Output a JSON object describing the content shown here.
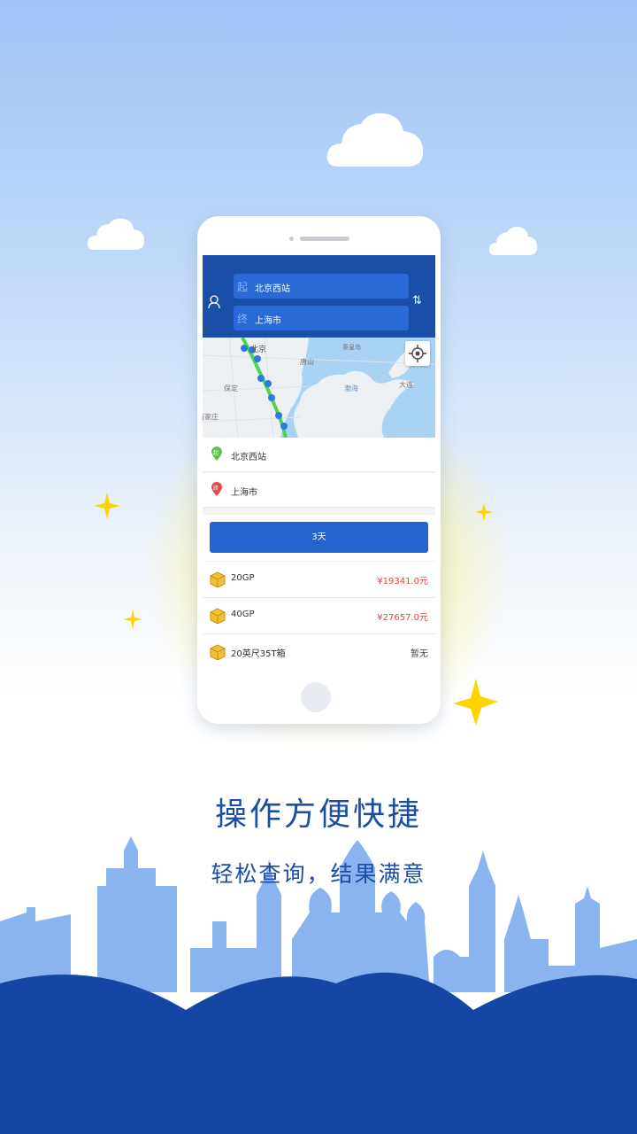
{
  "route": {
    "origin_tag": "起",
    "origin_value": "北京西站",
    "destination_tag": "终",
    "destination_value": "上海市",
    "swap_symbol": "⇅"
  },
  "map": {
    "labels": [
      "北京",
      "唐山",
      "秦皇岛",
      "保定",
      "渤海",
      "大连",
      "石家庄"
    ]
  },
  "stops": [
    {
      "badge": "起",
      "name": "北京西站",
      "color": "#5cc24a"
    },
    {
      "badge": "终",
      "name": "上海市",
      "color": "#e24a4a"
    }
  ],
  "duration_button": "3天",
  "quotes": [
    {
      "container": "20GP",
      "price": "¥19341.0元"
    },
    {
      "container": "40GP",
      "price": "¥27657.0元"
    },
    {
      "container": "20英尺35T箱",
      "price": "暂无"
    }
  ],
  "headline": "操作方便快捷",
  "subline": "轻松查询，结果满意",
  "colors": {
    "brand_blue": "#1a4fa8",
    "button_blue": "#2563cf",
    "price_red": "#e64545",
    "star_yellow": "#ffd400",
    "dark_band": "#1447a3"
  }
}
